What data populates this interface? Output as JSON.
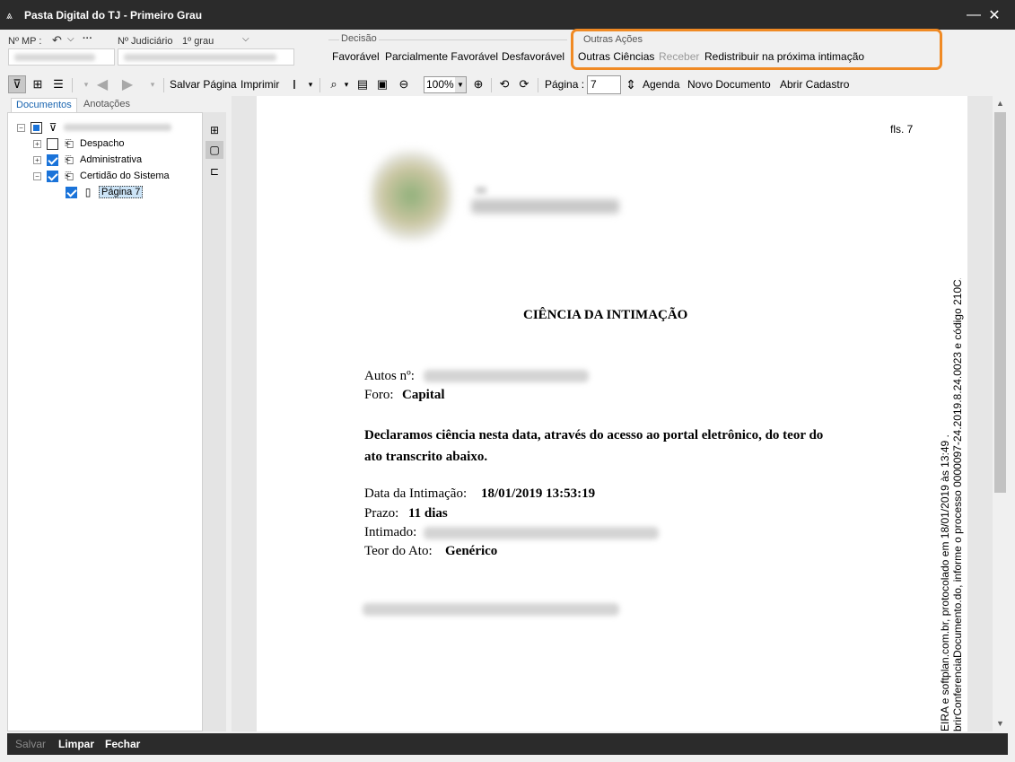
{
  "window": {
    "title": "Pasta Digital do TJ - Primeiro Grau",
    "minimize_label": "—",
    "close_label": "✕"
  },
  "header": {
    "nmp_label": "Nº MP :",
    "judiciario_label": "Nº Judiciário",
    "grau_label": "1º grau",
    "decisao": {
      "title": "Decisão",
      "buttons": [
        "Favorável",
        "Parcialmente Favorável",
        "Desfavorável"
      ]
    },
    "outras_acoes": {
      "title": "Outras Ações",
      "outras_ciencias": "Outras Ciências",
      "receber": "Receber",
      "redistribuir": "Redistribuir na próxima intimação"
    }
  },
  "toolbar": {
    "salvar_pagina": "Salvar Página",
    "imprimir": "Imprimir",
    "zoom": "100%",
    "pagina_label": "Página :",
    "pagina_value": "7",
    "agenda": "Agenda",
    "novo_documento": "Novo Documento",
    "abrir_cadastro": "Abrir Cadastro"
  },
  "tabs": [
    "Documentos",
    "Anotações"
  ],
  "tree": {
    "items": [
      {
        "label": "Despacho",
        "checked": false
      },
      {
        "label": "Administrativa",
        "checked": true
      },
      {
        "label": "Certidão do Sistema",
        "checked": true
      },
      {
        "label": "Página 7",
        "checked": true
      }
    ]
  },
  "document": {
    "fls": "fls. 7",
    "title": "CIÊNCIA DA INTIMAÇÃO",
    "autos_label": "Autos nº:",
    "foro_label": "Foro:",
    "foro_value": "Capital",
    "declaration_line1": "Declaramos ciência nesta data, através do acesso ao portal eletrônico, do teor do",
    "declaration_line2": "ato transcrito abaixo.",
    "data_label": "Data da Intimação:",
    "data_value": "18/01/2019 13:53:19",
    "prazo_label": "Prazo:",
    "prazo_value": "11 dias",
    "intimado_label": "Intimado:",
    "teor_label": "Teor do Ato:",
    "teor_value": "Genérico",
    "side_line1": "EIRA e softplan.com.br, protocolado em 18/01/2019 às 13:49 .",
    "side_line2": "brirConferenciaDocumento.do, informe o processo 0000097-24.2019.8.24.0023 e código 210C."
  },
  "bottom": {
    "salvar": "Salvar",
    "limpar": "Limpar",
    "fechar": "Fechar"
  },
  "colors": {
    "highlight": "#f08a24",
    "titlebar": "#2b2b2b",
    "checkbox": "#1a73d9"
  }
}
